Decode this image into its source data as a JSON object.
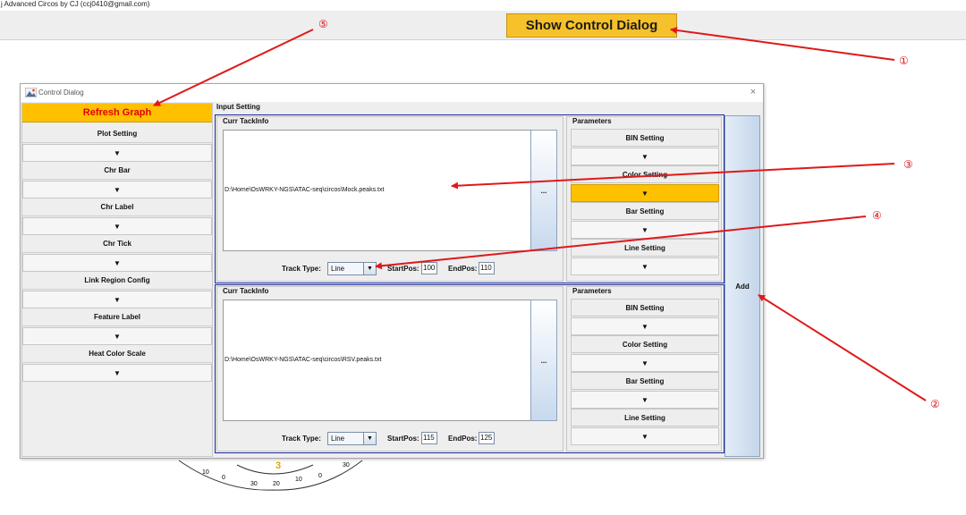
{
  "main_window": {
    "title": "j Advanced Circos by CJ (ccj0410@gmail.com)",
    "show_button": "Show Control Dialog"
  },
  "dialog": {
    "title": "Control Dialog",
    "close_glyph": "×",
    "refresh_button": "Refresh Graph",
    "left_items": [
      {
        "label": "Plot Setting",
        "arrow": "▼"
      },
      {
        "label": "Chr Bar",
        "arrow": "▼"
      },
      {
        "label": "Chr Label",
        "arrow": "▼"
      },
      {
        "label": "Chr Tick",
        "arrow": "▼"
      },
      {
        "label": "Link Region Config",
        "arrow": "▼"
      },
      {
        "label": "Feature Label",
        "arrow": "▼"
      },
      {
        "label": "Heat Color Scale",
        "arrow": "▼"
      }
    ],
    "input_setting": "Input Setting",
    "add_button": "Add",
    "tracks": [
      {
        "tack_label": "Curr TackInfo",
        "path": "D:\\Home\\OsWRKY-NGS\\ATAC-seq\\circos\\Mock.peaks.txt",
        "browse": "...",
        "track_type_label": "Track Type:",
        "track_type": "Line",
        "start_label": "StartPos:",
        "start": "100",
        "end_label": "EndPos:",
        "end": "110",
        "params_label": "Parameters",
        "params": [
          {
            "label": "BIN Setting",
            "arrow": "▼",
            "selected": false
          },
          {
            "label": "Color Setting",
            "arrow": "▼",
            "selected": true
          },
          {
            "label": "Bar Setting",
            "arrow": "▼",
            "selected": false
          },
          {
            "label": "Line Setting",
            "arrow": "▼",
            "selected": false
          }
        ]
      },
      {
        "tack_label": "Curr TackInfo",
        "path": "D:\\Home\\OsWRKY-NGS\\ATAC-seq\\circos\\RSV.peaks.txt",
        "browse": "...",
        "track_type_label": "Track Type:",
        "track_type": "Line",
        "start_label": "StartPos:",
        "start": "115",
        "end_label": "EndPos:",
        "end": "125",
        "params_label": "Parameters",
        "params": [
          {
            "label": "BIN Setting",
            "arrow": "▼",
            "selected": false
          },
          {
            "label": "Color Setting",
            "arrow": "▼",
            "selected": false
          },
          {
            "label": "Bar Setting",
            "arrow": "▼",
            "selected": false
          },
          {
            "label": "Line Setting",
            "arrow": "▼",
            "selected": false
          }
        ]
      }
    ]
  },
  "background_chart": {
    "center_label": "3",
    "ticks": [
      "10",
      "0",
      "30",
      "20",
      "10",
      "0",
      "30"
    ]
  },
  "annotations": {
    "color": "#e01818",
    "numbers": [
      "①",
      "②",
      "③",
      "④",
      "⑤"
    ]
  },
  "colors": {
    "accent_yellow": "#ffc000",
    "button_yellow": "#f6c12a",
    "refresh_text": "#e00000",
    "track_border": "#1a2a9a"
  }
}
